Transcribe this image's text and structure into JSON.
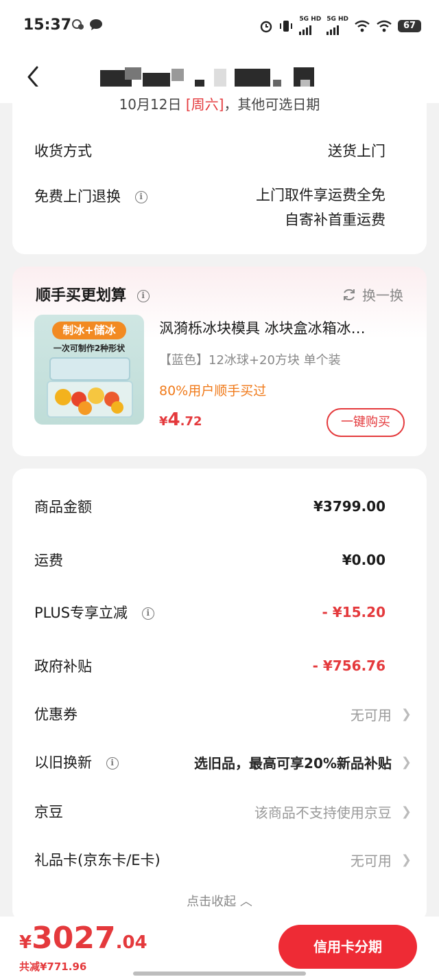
{
  "status_bar": {
    "time": "15:37",
    "battery": "67",
    "net1": "5G HD",
    "net2": "5G HD"
  },
  "delivery": {
    "clipped_date_line": "10月12日 [周六]，其他可选日期",
    "clipped_day": "[周六]",
    "method_label": "收货方式",
    "method_value": "送货上门",
    "return_label": "免费上门退换",
    "return_value_1": "上门取件享运费全免",
    "return_value_2": "自寄补首重运费"
  },
  "recommend": {
    "title": "顺手买更划算",
    "swap_label": "换一换",
    "product": {
      "image_badge": "制冰+储冰",
      "image_sub": "一次可制作2种形状",
      "name": "沨漪栎冰块模具 冰块盒冰箱冰…",
      "spec": "【蓝色】12冰球+20方块 单个装",
      "social": "80%用户顺手买过",
      "price_currency": "¥",
      "price_int": "4",
      "price_dec": ".72",
      "buy_label": "一键购买"
    }
  },
  "price_detail": {
    "rows": [
      {
        "label": "商品金额",
        "value": "¥3799.00"
      },
      {
        "label": "运费",
        "value": "¥0.00"
      },
      {
        "label": "PLUS专享立减",
        "value": "- ¥15.20"
      },
      {
        "label": "政府补贴",
        "value": "- ¥756.76"
      },
      {
        "label": "优惠券",
        "value": "无可用"
      },
      {
        "label": "以旧换新",
        "value": "选旧品，最高可享20%新品补贴"
      },
      {
        "label": "京豆",
        "value": "该商品不支持使用京豆"
      },
      {
        "label": "礼品卡(京东卡/E卡)",
        "value": "无可用"
      }
    ],
    "collapse_label": "点击收起 ︿"
  },
  "bottom": {
    "currency": "¥",
    "total_int": "3027",
    "total_dec": ".04",
    "saved": "共减¥771.96",
    "pay_label": "信用卡分期"
  }
}
